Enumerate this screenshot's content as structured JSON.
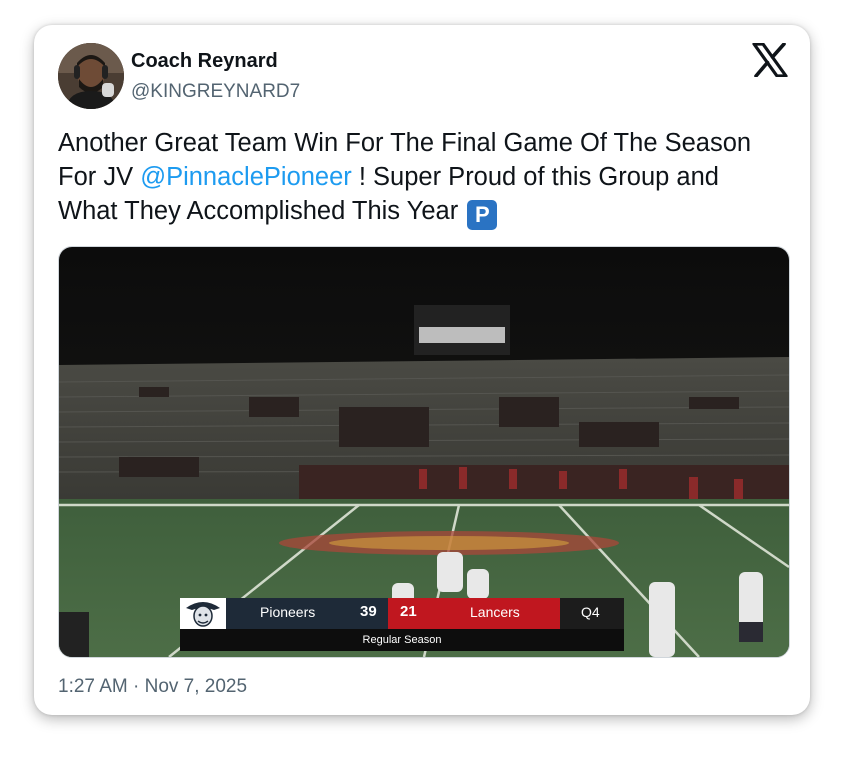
{
  "tweet": {
    "author_name": "Coach Reynard",
    "author_handle": "@KINGREYNARD7",
    "text_before": "Another Great Team Win For The Final Game Of The Season For JV ",
    "mention": "@PinnaclePioneer",
    "text_after": " ! Super Proud of this Group and What They Accomplished This Year ",
    "emoji_label": "P",
    "timestamp": "1:27 AM · Nov 7, 2025"
  },
  "scoreboard": {
    "home_team": "Pioneers",
    "home_score": "39",
    "away_score": "21",
    "away_team": "Lancers",
    "period": "Q4",
    "subtitle": "Regular Season"
  },
  "colors": {
    "home_bar": "#1e2a38",
    "away_bar": "#c0171f",
    "mention": "#1d9bf0"
  },
  "icons": [
    "x-logo-icon",
    "p-button-emoji",
    "pioneer-logo-icon"
  ]
}
